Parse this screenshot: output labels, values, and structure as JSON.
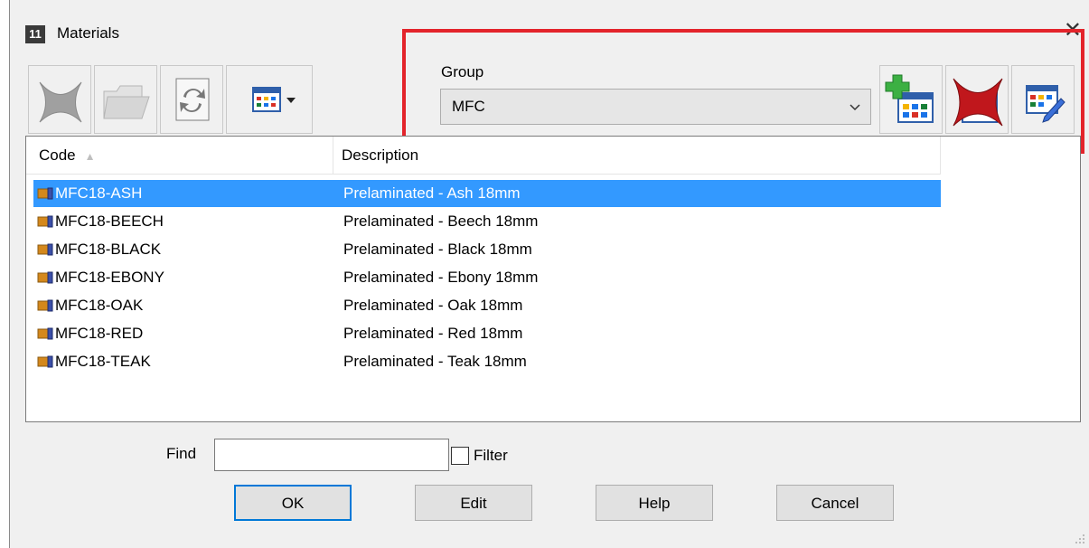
{
  "window": {
    "app_icon_text": "11",
    "title": "Materials",
    "close_glyph": "✕"
  },
  "toolbar": {
    "buttons": [
      {
        "name": "delete-button",
        "icon": "delete-x-icon",
        "enabled": false
      },
      {
        "name": "open-folder-button",
        "icon": "folder-icon",
        "enabled": false
      },
      {
        "name": "refresh-button",
        "icon": "refresh-icon",
        "enabled": true
      },
      {
        "name": "view-dropdown-button",
        "icon": "grid-dropdown-icon",
        "enabled": true
      }
    ]
  },
  "group": {
    "label": "Group",
    "selected": "MFC",
    "actions": [
      {
        "name": "add-group-button",
        "icon": "add-grid-icon"
      },
      {
        "name": "delete-group-button",
        "icon": "delete-grid-icon"
      },
      {
        "name": "edit-group-button",
        "icon": "edit-grid-icon"
      }
    ]
  },
  "list": {
    "columns": [
      {
        "label": "Code",
        "sort": "ascending"
      },
      {
        "label": "Description"
      }
    ],
    "rows": [
      {
        "code": "MFC18-ASH",
        "description": "Prelaminated - Ash 18mm",
        "selected": true
      },
      {
        "code": "MFC18-BEECH",
        "description": "Prelaminated - Beech 18mm",
        "selected": false
      },
      {
        "code": "MFC18-BLACK",
        "description": "Prelaminated - Black 18mm",
        "selected": false
      },
      {
        "code": "MFC18-EBONY",
        "description": "Prelaminated - Ebony 18mm",
        "selected": false
      },
      {
        "code": "MFC18-OAK",
        "description": "Prelaminated - Oak 18mm",
        "selected": false
      },
      {
        "code": "MFC18-RED",
        "description": "Prelaminated - Red 18mm",
        "selected": false
      },
      {
        "code": "MFC18-TEAK",
        "description": "Prelaminated - Teak 18mm",
        "selected": false
      }
    ]
  },
  "find": {
    "label": "Find",
    "value": "",
    "filter_label": "Filter",
    "filter_checked": false
  },
  "buttons": {
    "ok": "OK",
    "edit": "Edit",
    "help": "Help",
    "cancel": "Cancel"
  },
  "colors": {
    "selection": "#3399ff",
    "highlight_box": "#e3242b",
    "default_button_border": "#0078d7"
  }
}
